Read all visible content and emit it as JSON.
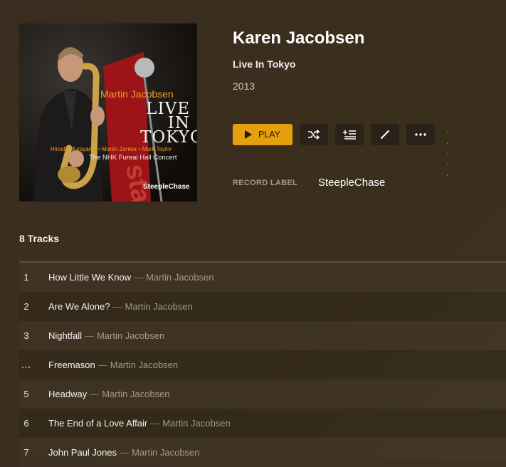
{
  "album": {
    "cover": {
      "artist": "Martin Jacobsen",
      "title_lines": [
        "LIVE",
        "IN",
        "TOKYO"
      ],
      "musicians": "Hiroshi Murayama • Martin Zenker • Mark Taylor",
      "concert": "The NHK Fureai Hall Concert",
      "label": "SteepleChase"
    },
    "artist": "Karen Jacobsen",
    "title": "Live In Tokyo",
    "year": "2013"
  },
  "toolbar": {
    "play_label": "PLAY",
    "icons": [
      "play-icon",
      "shuffle-icon",
      "add-to-queue-icon",
      "edit-icon",
      "more-icon"
    ],
    "trailing_dots": "· · · · ·"
  },
  "metadata": {
    "record_label_key": "RECORD LABEL",
    "record_label_value": "SteepleChase"
  },
  "tracks": {
    "count_label": "8 Tracks",
    "items": [
      {
        "number": "1",
        "title": "How Little We Know",
        "sep": "—",
        "artist": "Martin Jacobsen"
      },
      {
        "number": "2",
        "title": "Are We Alone?",
        "sep": "—",
        "artist": "Martin Jacobsen"
      },
      {
        "number": "3",
        "title": "Nightfall",
        "sep": "—",
        "artist": "Martin Jacobsen"
      },
      {
        "number": "...",
        "title": "Freemason",
        "sep": "—",
        "artist": "Martin Jacobsen"
      },
      {
        "number": "5",
        "title": "Headway",
        "sep": "—",
        "artist": "Martin Jacobsen"
      },
      {
        "number": "6",
        "title": "The End of a Love Affair",
        "sep": "—",
        "artist": "Martin Jacobsen"
      },
      {
        "number": "7",
        "title": "John Paul Jones",
        "sep": "—",
        "artist": "Martin Jacobsen"
      }
    ]
  },
  "colors": {
    "accent": "#e5a00d",
    "background": "#3a2d1f"
  }
}
